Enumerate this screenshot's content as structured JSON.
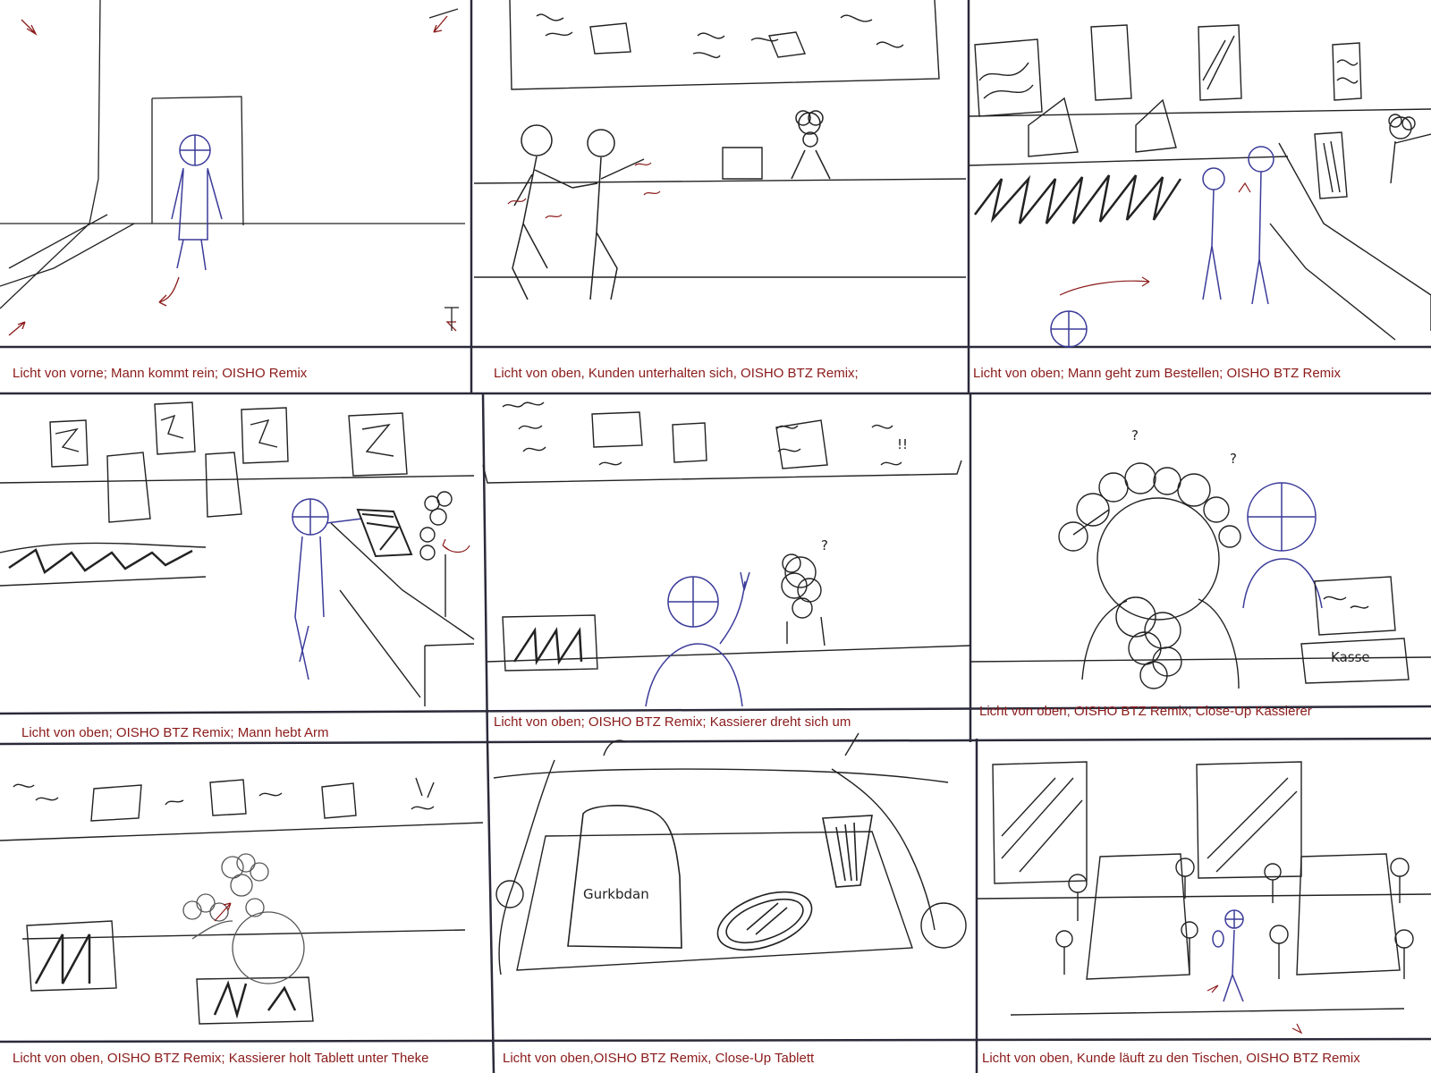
{
  "storyboard": {
    "panels": [
      {
        "caption": "Licht von vorne; Mann kommt rein; OISHO Remix"
      },
      {
        "caption": "Licht von oben, Kunden unterhalten sich, OISHO BTZ Remix;"
      },
      {
        "caption": "Licht von oben; Mann geht zum Bestellen; OISHO BTZ Remix"
      },
      {
        "caption": "Licht von oben; OISHO BTZ Remix; Mann hebt Arm"
      },
      {
        "caption": "Licht von oben; OISHO BTZ Remix;  Kassierer dreht sich um"
      },
      {
        "caption": "Licht von oben; OISHO BTZ Remix; Close-Up Kassierer"
      },
      {
        "caption": "Licht von oben, OISHO BTZ Remix; Kassierer holt Tablett unter Theke"
      },
      {
        "caption": "Licht von oben,OISHO BTZ Remix, Close-Up Tablett"
      },
      {
        "caption": "Licht von oben, Kunde läuft zu den Tischen, OISHO BTZ Remix"
      }
    ],
    "sketch_text": {
      "kasse": "Kasse",
      "gurkeblatt": "Gurkbdan",
      "question_mark": "?",
      "exclamations": "!!"
    },
    "colors": {
      "pencil": "#222222",
      "person_blue": "#3b3b9a",
      "annotation_red": "#8b1a1a",
      "grid": "#2a2a3a"
    }
  }
}
